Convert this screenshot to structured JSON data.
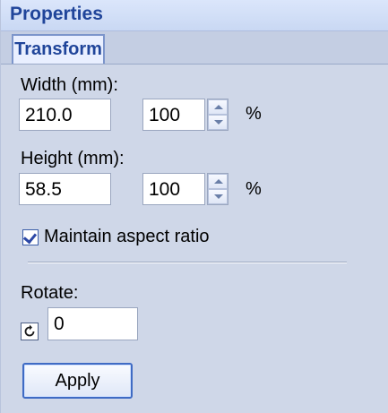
{
  "panel": {
    "title": "Properties",
    "tabs": [
      {
        "label": "Transform",
        "active": true
      }
    ]
  },
  "transform": {
    "width_label": "Width (mm):",
    "width_value": "210.0",
    "width_percent": "100",
    "width_percent_unit": "%",
    "height_label": "Height (mm):",
    "height_value": "58.5",
    "height_percent": "100",
    "height_percent_unit": "%",
    "aspect_label": "Maintain aspect ratio",
    "aspect_checked": true,
    "rotate_label": "Rotate:",
    "rotate_value": "0",
    "apply_label": "Apply"
  },
  "colors": {
    "panel_bg": "#cfd7e8",
    "header_text": "#20459a",
    "tab_bg": "#e9efff",
    "button_border": "#3f6bc4"
  },
  "icons": {
    "rotate": "rotate-ccw-icon",
    "spin_up": "arrow-up-icon",
    "spin_down": "arrow-down-icon",
    "check": "checkmark-icon"
  }
}
